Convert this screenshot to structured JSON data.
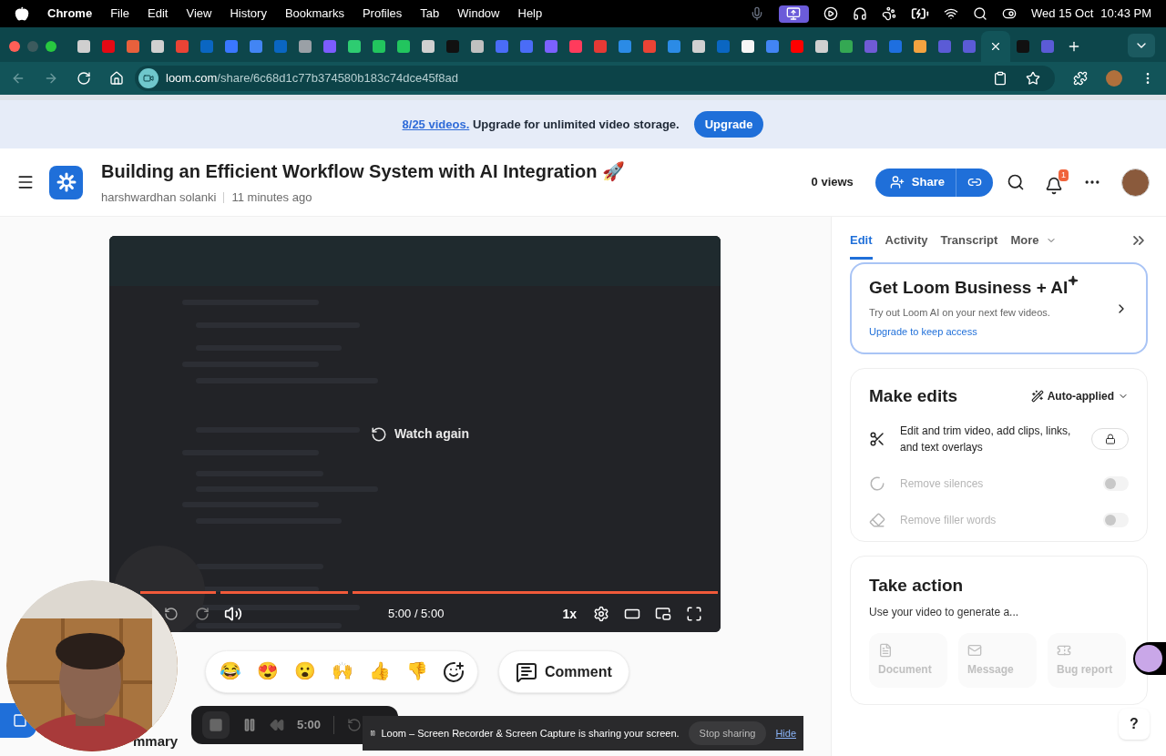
{
  "menu_bar": {
    "app": "Chrome",
    "menus": [
      "File",
      "Edit",
      "View",
      "History",
      "Bookmarks",
      "Profiles",
      "Tab",
      "Window",
      "Help"
    ],
    "date": "Wed 15 Oct",
    "time": "10:43 PM"
  },
  "browser": {
    "tabs": [
      {
        "color": "#cfcfcf",
        "selected": false
      },
      {
        "color": "#e50914",
        "selected": false
      },
      {
        "color": "#e8603c",
        "selected": false
      },
      {
        "color": "#d0d0d0",
        "selected": false
      },
      {
        "color": "#ea4335",
        "selected": false
      },
      {
        "color": "#0a66c2",
        "selected": false
      },
      {
        "color": "#3a77ff",
        "selected": false
      },
      {
        "color": "#4285f4",
        "selected": false
      },
      {
        "color": "#0a66c2",
        "selected": false
      },
      {
        "color": "#9aa0a6",
        "selected": false
      },
      {
        "color": "#7c5cff",
        "selected": false
      },
      {
        "color": "#2ecc71",
        "selected": false
      },
      {
        "color": "#22c55e",
        "selected": false
      },
      {
        "color": "#22c55e",
        "selected": false
      },
      {
        "color": "#d0d0d0",
        "selected": false
      },
      {
        "color": "#111111",
        "selected": false
      },
      {
        "color": "#c0c0c0",
        "selected": false
      },
      {
        "color": "#4a6cf7",
        "selected": false
      },
      {
        "color": "#4a6cf7",
        "selected": false
      },
      {
        "color": "#7b61ff",
        "selected": false
      },
      {
        "color": "#ff3b5c",
        "selected": false
      },
      {
        "color": "#e53935",
        "selected": false
      },
      {
        "color": "#2b8be6",
        "selected": false
      },
      {
        "color": "#ea4335",
        "selected": false
      },
      {
        "color": "#2b8be6",
        "selected": false
      },
      {
        "color": "#d0d0d0",
        "selected": false
      },
      {
        "color": "#0a66c2",
        "selected": false
      },
      {
        "color": "#f5f5f5",
        "selected": false
      },
      {
        "color": "#4285f4",
        "selected": false
      },
      {
        "color": "#ff0000",
        "selected": false
      },
      {
        "color": "#d0d0d0",
        "selected": false
      },
      {
        "color": "#34a853",
        "selected": false
      },
      {
        "color": "#6f5bd6",
        "selected": false
      },
      {
        "color": "#1e6fe0",
        "selected": false
      },
      {
        "color": "#f4a340",
        "selected": false
      },
      {
        "color": "#5b5bd6",
        "selected": false
      },
      {
        "color": "#5b5bd6",
        "selected": false
      },
      {
        "selected": true
      },
      {
        "color": "#111111",
        "selected": false
      },
      {
        "color": "#5b5bd6",
        "selected": false
      }
    ],
    "url_host": "loom.com",
    "url_path": "/share/6c68d1c77b374580b183c74dce45f8ad"
  },
  "banner": {
    "count_link": "8/25 videos.",
    "message": "Upgrade for unlimited video storage.",
    "button": "Upgrade"
  },
  "header": {
    "title": "Building an Efficient Workflow System with AI Integration 🚀",
    "author": "harshwardhan solanki",
    "time": "11 minutes ago",
    "views": "0 views",
    "share": "Share",
    "notifications": "1"
  },
  "video": {
    "overlay": "Watch again",
    "progress": {
      "level": 1
    },
    "time": "5:00 / 5:00",
    "speed": "1x"
  },
  "reactions": [
    "😂",
    "😍",
    "😮",
    "🙌",
    "👍",
    "👎"
  ],
  "comment": "Comment",
  "summary_heading": "mmary",
  "recorder": {
    "time": "5:00"
  },
  "sharing_bar": {
    "message": "Loom – Screen Recorder & Screen Capture is sharing your screen.",
    "stop": "Stop sharing",
    "hide": "Hide"
  },
  "panel": {
    "tabs": [
      {
        "label": "Edit",
        "selected": true
      },
      {
        "label": "Activity",
        "selected": false
      },
      {
        "label": "Transcript",
        "selected": false
      },
      {
        "label": "More",
        "selected": false
      }
    ],
    "promo": {
      "title": "Get Loom Business + AI",
      "text": "Try out Loom AI on your next few videos.",
      "link": "Upgrade to keep access"
    },
    "edits": {
      "title": "Make edits",
      "mode": "Auto-applied",
      "rows": [
        {
          "kind": "locked",
          "label": "Edit and trim video, add clips, links, and text overlays",
          "disabled": false
        },
        {
          "kind": "toggle",
          "label": "Remove silences",
          "disabled": true,
          "on": false
        },
        {
          "kind": "toggle",
          "label": "Remove filler words",
          "disabled": true,
          "on": false
        }
      ]
    },
    "action": {
      "title": "Take action",
      "text": "Use your video to generate a...",
      "buttons": [
        {
          "kind": "document",
          "label": "Document",
          "disabled": true
        },
        {
          "kind": "message",
          "label": "Message",
          "disabled": true
        },
        {
          "kind": "bug",
          "label": "Bug report",
          "disabled": true
        }
      ]
    },
    "help": "?"
  }
}
